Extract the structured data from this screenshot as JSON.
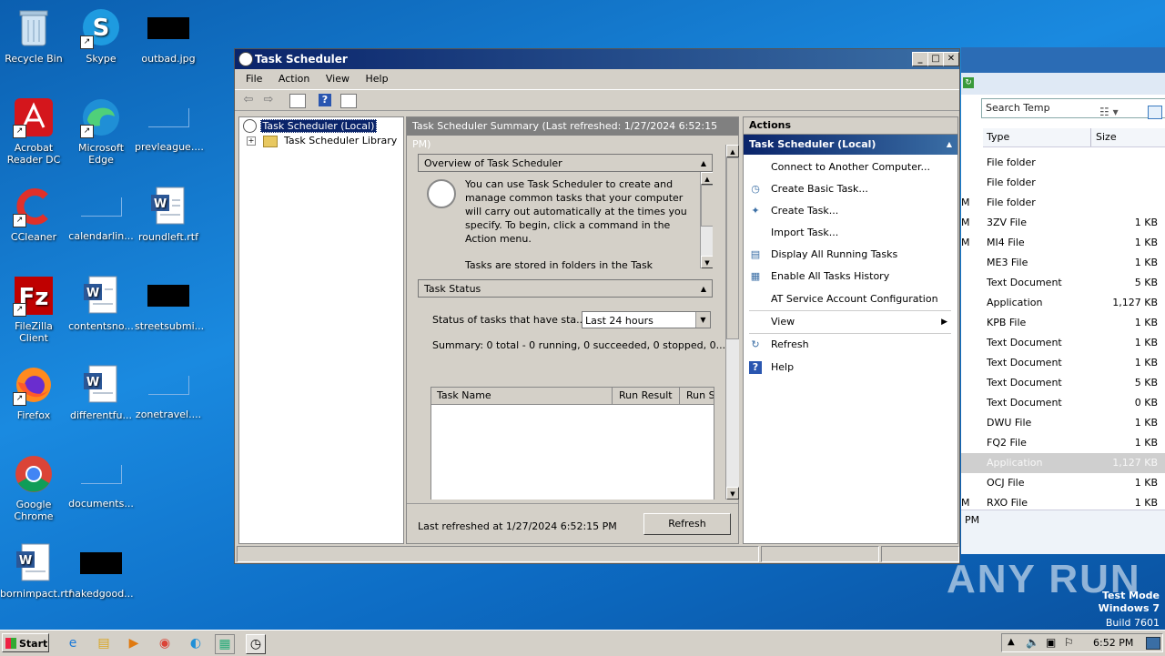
{
  "desktop": {
    "icons": [
      {
        "label": "Recycle Bin"
      },
      {
        "label": "Skype"
      },
      {
        "label": "outbad.jpg"
      },
      {
        "label": "Acrobat Reader DC"
      },
      {
        "label": "Microsoft Edge"
      },
      {
        "label": "prevleague...."
      },
      {
        "label": "CCleaner"
      },
      {
        "label": "calendarlin..."
      },
      {
        "label": "roundleft.rtf"
      },
      {
        "label": "FileZilla Client"
      },
      {
        "label": "contentsno..."
      },
      {
        "label": "streetsubmi..."
      },
      {
        "label": "Firefox"
      },
      {
        "label": "differentfu..."
      },
      {
        "label": "zonetravel...."
      },
      {
        "label": "Google Chrome"
      },
      {
        "label": "documents..."
      },
      {
        "label": "bornimpact.rtf"
      },
      {
        "label": "nakedgood..."
      }
    ]
  },
  "explorer": {
    "search_placeholder": "Search Temp",
    "col_type": "Type",
    "col_size": "Size",
    "rows": [
      {
        "m": "",
        "type": "File folder",
        "size": ""
      },
      {
        "m": "",
        "type": "File folder",
        "size": ""
      },
      {
        "m": "M",
        "type": "File folder",
        "size": ""
      },
      {
        "m": "M",
        "type": "3ZV File",
        "size": "1 KB"
      },
      {
        "m": "M",
        "type": "MI4 File",
        "size": "1 KB"
      },
      {
        "m": "",
        "type": "ME3 File",
        "size": "1 KB"
      },
      {
        "m": "",
        "type": "Text Document",
        "size": "5 KB"
      },
      {
        "m": "",
        "type": "Application",
        "size": "1,127 KB"
      },
      {
        "m": "",
        "type": "KPB File",
        "size": "1 KB"
      },
      {
        "m": "",
        "type": "Text Document",
        "size": "1 KB"
      },
      {
        "m": "",
        "type": "Text Document",
        "size": "1 KB"
      },
      {
        "m": "",
        "type": "Text Document",
        "size": "5 KB"
      },
      {
        "m": "",
        "type": "Text Document",
        "size": "0 KB"
      },
      {
        "m": "",
        "type": "DWU File",
        "size": "1 KB"
      },
      {
        "m": "",
        "type": "FQ2 File",
        "size": "1 KB"
      },
      {
        "m": "",
        "type": "Application",
        "size": "1,127 KB"
      },
      {
        "m": "",
        "type": "OCJ File",
        "size": "1 KB"
      },
      {
        "m": "M",
        "type": "RXO File",
        "size": "1 KB"
      }
    ],
    "details_text": "PM"
  },
  "window": {
    "title": "Task Scheduler",
    "menu": [
      "File",
      "Action",
      "View",
      "Help"
    ],
    "tree": {
      "root": "Task Scheduler (Local)",
      "child": "Task Scheduler Library"
    },
    "summary_title": "Task Scheduler Summary (Last refreshed: 1/27/2024 6:52:15 PM)",
    "overview": {
      "heading": "Overview of Task Scheduler",
      "text": "You can use Task Scheduler to create and manage common tasks that your computer will carry out automatically at the times you specify. To begin, click a command in the Action menu.",
      "text2": "Tasks are stored in folders in the Task"
    },
    "task_status": {
      "heading": "Task Status",
      "filter_label": "Status of tasks that have sta...",
      "filter_value": "Last 24 hours",
      "summary": "Summary: 0 total - 0 running, 0 succeeded, 0 stopped, 0...",
      "columns": [
        "Task Name",
        "Run Result",
        "Run S"
      ]
    },
    "last_refreshed": "Last refreshed at 1/27/2024 6:52:15 PM",
    "refresh_button": "Refresh",
    "actions": {
      "heading": "Actions",
      "subheading": "Task Scheduler (Local)",
      "items": [
        {
          "label": "Connect to Another Computer...",
          "icon": ""
        },
        {
          "label": "Create Basic Task...",
          "icon": "create-basic-task-icon"
        },
        {
          "label": "Create Task...",
          "icon": "create-task-icon"
        },
        {
          "label": "Import Task...",
          "icon": ""
        },
        {
          "label": "Display All Running Tasks",
          "icon": "running-tasks-icon"
        },
        {
          "label": "Enable All Tasks History",
          "icon": "history-icon"
        },
        {
          "label": "AT Service Account Configuration",
          "icon": ""
        },
        {
          "label": "View",
          "icon": ""
        },
        {
          "label": "Refresh",
          "icon": "refresh-icon"
        },
        {
          "label": "Help",
          "icon": "help-icon"
        }
      ]
    }
  },
  "taskbar": {
    "start_label": "Start",
    "clock": "6:52 PM"
  },
  "watermark": {
    "brand": "ANY RUN",
    "line1": "Test Mode",
    "line2": "Windows 7",
    "line3": "Build 7601"
  }
}
